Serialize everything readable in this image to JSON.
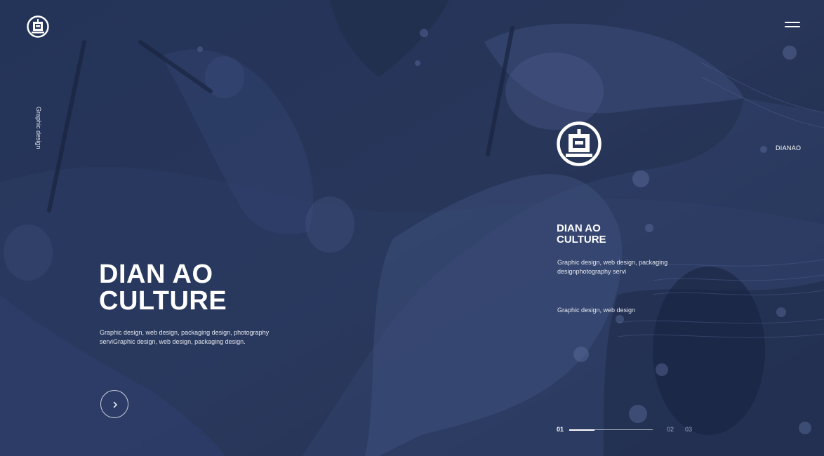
{
  "header": {
    "logo_icon": "dianao-logo-icon",
    "menu_icon": "hamburger-menu-icon"
  },
  "side_label": "Graphic design",
  "hero": {
    "title_line1": "DIAN AO",
    "title_line2": "CULTURE",
    "description": "Graphic design, web design, packaging design, photography serviGraphic design, web design, packaging design.",
    "next_icon": "chevron-right-icon"
  },
  "card": {
    "brand": "DIANAO",
    "title_line1": "DIAN AO",
    "title_line2": "CULTURE",
    "description": "Graphic design, web design, packaging designphotography servi",
    "subtitle": "Graphic design, web design"
  },
  "pager": {
    "current": "01",
    "items": [
      "02",
      "03"
    ],
    "progress": 0.3
  },
  "colors": {
    "overlay": "#26345a",
    "text": "#ffffff",
    "muted": "#9aa6c3"
  }
}
